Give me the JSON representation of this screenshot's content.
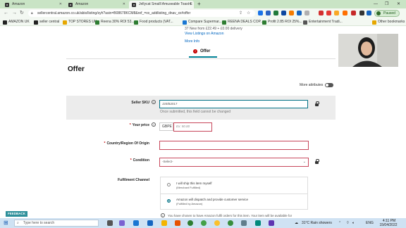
{
  "tabs": [
    {
      "title": "Amazon",
      "active": false
    },
    {
      "title": "Amazon",
      "active": false
    },
    {
      "title": "Jellycat Smalll Amuseable Toast E",
      "active": true
    }
  ],
  "address_bar": {
    "url": "sellercentral.amazon.co.uk/abis/listing/syh?asin=B08678KCM8&ref_=xx_addlisting_dnav_xx#offer"
  },
  "profile": {
    "label": "Paused"
  },
  "bookmarks": [
    "AMAZON UK",
    "seller central",
    "TOP STORES UK",
    "Reena 30% ROI 53...",
    "Food products (VAT...",
    "Compare Supermar...",
    "REENA DEALS COP...",
    "Profit 2.85 ROI 25%...",
    "Entertainment Tradi..."
  ],
  "other_bookmarks": "Other bookmarks",
  "top_info": {
    "line1": "37 New  from £22.49 + £0.00 delivery",
    "view_listings": "View Listings on Amazon",
    "more_info": "More Info"
  },
  "offer_tab": {
    "label": "Offer",
    "badge": "!"
  },
  "page_title": "Offer",
  "more_attributes": "More attributes",
  "form": {
    "seller_sku": {
      "label": "Seller SKU",
      "value": "J20/B2017",
      "hint": "Once submitted, this field cannot be changed"
    },
    "your_price": {
      "label": "Your price",
      "currency": "GBPE",
      "placeholder": "Ex: 50.00"
    },
    "country_origin": {
      "label": "Country/Region Of Origin"
    },
    "condition": {
      "label": "Condition",
      "value": "-Select-"
    },
    "fulfilment": {
      "label": "Fulfilment Channel",
      "options": [
        {
          "title": "I will ship this item myself",
          "sub": "(Merchant Fulfilled)",
          "selected": false
        },
        {
          "title": "Amazon will dispatch and provide customer service",
          "sub": "(Fulfilled by Amazon)",
          "selected": true
        }
      ],
      "note": "You have chosen to have Amazon fulfil orders for this item. Your item will be available for"
    }
  },
  "feedback_label": "FEEDBACK",
  "taskbar": {
    "search_placeholder": "Type here to search",
    "weather": "31°C  Rain showers",
    "lang": "ENG",
    "time": "4:11 PM",
    "date": "15/04/2022"
  }
}
